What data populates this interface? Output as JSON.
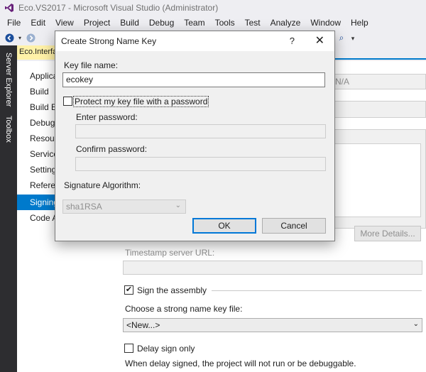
{
  "window": {
    "title": "Eco.VS2017 - Microsoft Visual Studio (Administrator)"
  },
  "menu": [
    "File",
    "Edit",
    "View",
    "Project",
    "Build",
    "Debug",
    "Team",
    "Tools",
    "Test",
    "Analyze",
    "Window",
    "Help"
  ],
  "side_tabs": {
    "server_explorer": "Server Explorer",
    "toolbox": "Toolbox"
  },
  "doc_tab": "Eco.Interfa",
  "nav": [
    "Applica",
    "Build",
    "Build Ev",
    "Debug",
    "Resour",
    "Service",
    "Setting",
    "Referen",
    "Signing",
    "Code A"
  ],
  "nav_active": "Signing",
  "signing": {
    "certificate_combo": "N/A",
    "more_details": "More Details...",
    "timestamp_label": "Timestamp server URL:",
    "sign_assembly": "Sign the assembly",
    "choose_key_label": "Choose a strong name key file:",
    "key_file_value": "<New...>",
    "delay_sign": "Delay sign only",
    "delay_note": "When delay signed, the project will not run or be debuggable."
  },
  "dialog": {
    "title": "Create Strong Name Key",
    "help_icon": "?",
    "close_icon": "✕",
    "key_file_label": "Key file name:",
    "key_file_value": "ecokey",
    "protect_label": "Protect my key file with a password",
    "enter_password_label": "Enter password:",
    "confirm_password_label": "Confirm password:",
    "algorithm_label": "Signature Algorithm:",
    "algorithm_value": "sha1RSA",
    "ok": "OK",
    "cancel": "Cancel"
  },
  "colors": {
    "accent": "#007acc",
    "doc_tab": "#fff1a8",
    "dark_rail": "#2d2d30"
  }
}
